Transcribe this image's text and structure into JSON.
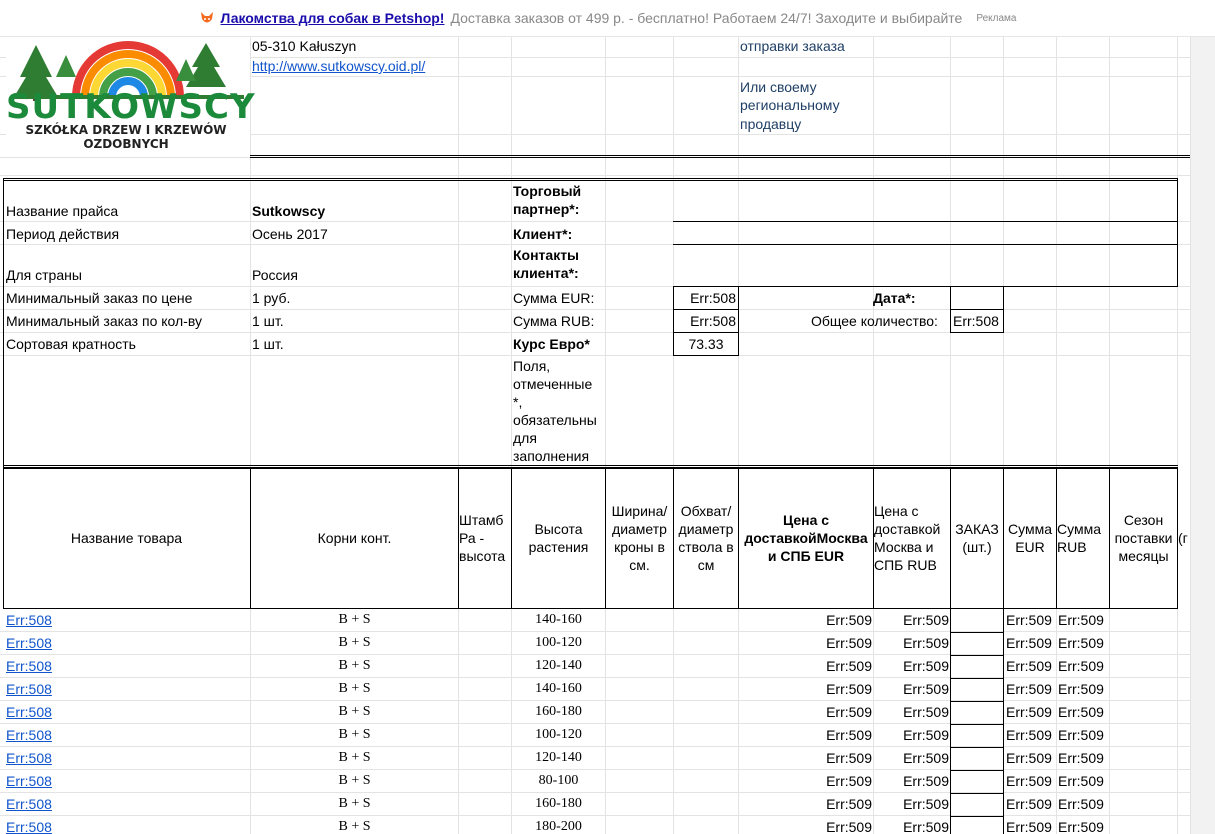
{
  "ad": {
    "link_text": "Лакомства для собак в Petshop!",
    "body_text": "Доставка заказов от 499 р. - бесплатно! Работаем 24/7! Заходите и выбирайте",
    "tag": "Реклама",
    "icon": "fox-icon"
  },
  "logo": {
    "brand": "SUTKOWSCY",
    "line1": "SZKÓŁKA DRZEW I KRZEWÓW",
    "line2": "OZDOBNYCH"
  },
  "address": {
    "postal": "05-310 Kałuszyn",
    "url": "http://www.sutkowscy.oid.pl/"
  },
  "note": {
    "line0": "отправки заказа",
    "line1": "Или своему",
    "line2": "региональному",
    "line3": "продавцу"
  },
  "info": {
    "rows": [
      {
        "label": "Название прайса",
        "value": "Sutkowscy"
      },
      {
        "label": "Период действия",
        "value": "Осень 2017"
      },
      {
        "label": "Для страны",
        "value": "Россия"
      },
      {
        "label": "Минимальный заказ по цене",
        "value": "1 руб."
      },
      {
        "label": "Минимальный заказ по кол-ву",
        "value": "1 шт."
      },
      {
        "label": "Сортовая кратность",
        "value": "1 шт."
      }
    ],
    "partner_label": "Торговый партнер*:",
    "client_label": "Клиент*:",
    "contacts_label": "Контакты клиента*:",
    "sum_eur_label": "Сумма EUR:",
    "sum_eur_value": "Err:508",
    "sum_rub_label": "Сумма RUB:",
    "sum_rub_value": "Err:508",
    "rate_label": "Курс Евро*",
    "rate_value": "73.33",
    "date_label": "Дата*:",
    "total_qty_label": "Общее количество:",
    "total_qty_value": "Err:508",
    "required_note": "Поля, отмеченные *, обязательны для заполнения"
  },
  "columns": [
    "Название товара",
    "Корни конт.",
    "Штамб Ра - высота",
    "Высота растения",
    "Ширина/ диаметр кроны в см.",
    "Обхват/ диаметр ствола в см",
    "Цена с доставкойМосква и СПБ EUR",
    "Цена с доставкой Москва и СПБ RUB",
    "ЗАКАЗ (шт.)",
    "Сумма EUR",
    "Сумма RUB",
    "Сезон поставки месяцы",
    "(г"
  ],
  "rows": [
    {
      "name": "Err:508",
      "roots": "B + S",
      "height": "140-160",
      "price_eur": "Err:509",
      "price_rub": "Err:509",
      "sum_eur": "Err:509",
      "sum_rub": "Err:509"
    },
    {
      "name": "Err:508",
      "roots": "B + S",
      "height": "100-120",
      "price_eur": "Err:509",
      "price_rub": "Err:509",
      "sum_eur": "Err:509",
      "sum_rub": "Err:509"
    },
    {
      "name": "Err:508",
      "roots": "B + S",
      "height": "120-140",
      "price_eur": "Err:509",
      "price_rub": "Err:509",
      "sum_eur": "Err:509",
      "sum_rub": "Err:509"
    },
    {
      "name": "Err:508",
      "roots": "B + S",
      "height": "140-160",
      "price_eur": "Err:509",
      "price_rub": "Err:509",
      "sum_eur": "Err:509",
      "sum_rub": "Err:509"
    },
    {
      "name": "Err:508",
      "roots": "B + S",
      "height": "160-180",
      "price_eur": "Err:509",
      "price_rub": "Err:509",
      "sum_eur": "Err:509",
      "sum_rub": "Err:509"
    },
    {
      "name": "Err:508",
      "roots": "B + S",
      "height": "100-120",
      "price_eur": "Err:509",
      "price_rub": "Err:509",
      "sum_eur": "Err:509",
      "sum_rub": "Err:509"
    },
    {
      "name": "Err:508",
      "roots": "B + S",
      "height": "120-140",
      "price_eur": "Err:509",
      "price_rub": "Err:509",
      "sum_eur": "Err:509",
      "sum_rub": "Err:509"
    },
    {
      "name": "Err:508",
      "roots": "B + S",
      "height": "80-100",
      "price_eur": "Err:509",
      "price_rub": "Err:509",
      "sum_eur": "Err:509",
      "sum_rub": "Err:509"
    },
    {
      "name": "Err:508",
      "roots": "B + S",
      "height": "160-180",
      "price_eur": "Err:509",
      "price_rub": "Err:509",
      "sum_eur": "Err:509",
      "sum_rub": "Err:509"
    },
    {
      "name": "Err:508",
      "roots": "B + S",
      "height": "180-200",
      "price_eur": "Err:509",
      "price_rub": "Err:509",
      "sum_eur": "Err:509",
      "sum_rub": "Err:509"
    }
  ]
}
